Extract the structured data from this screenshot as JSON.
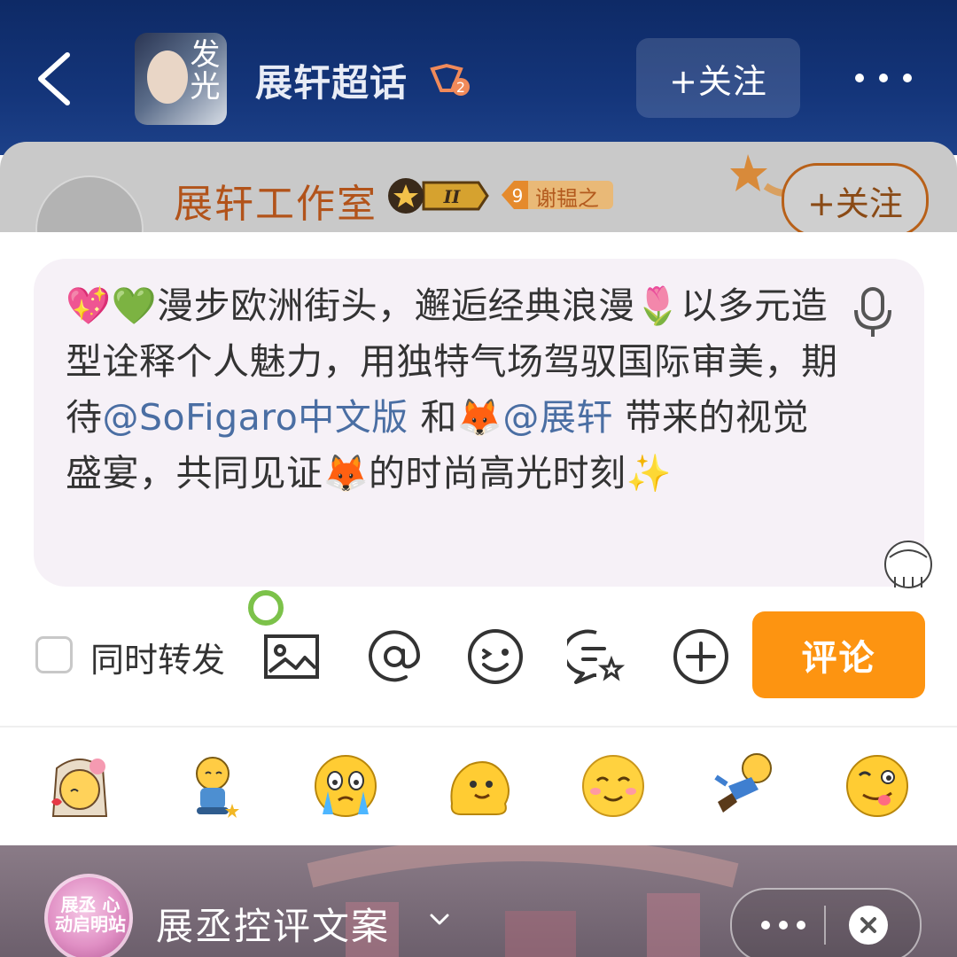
{
  "header": {
    "title": "展轩超话",
    "avatar_text": "发光",
    "level_badge": "2",
    "follow_label": "+关注"
  },
  "card": {
    "name": "展轩工作室",
    "crown_level": "II",
    "fan_level": "9",
    "fan_badge_text": "谢韫之",
    "follow_label": "+关注"
  },
  "comment": {
    "text_before": "💖💚漫步欧洲街头，邂逅经典浪漫🌷以多元造型诠释个人魅力，用独特气场驾驭国际审美，期待",
    "mention1": "@SoFigaro中文版",
    "text_middle": " 和🦊",
    "mention2": "@展轩",
    "text_after": " 带来的视觉盛宴，共同见证🦊的时尚高光时刻✨"
  },
  "toolbar": {
    "repost_label": "同时转发",
    "submit_label": "评论",
    "tools": [
      "image-icon",
      "at-icon",
      "emoji-icon",
      "topic-icon",
      "add-icon"
    ]
  },
  "emojis": [
    "veil-girl-emoji",
    "shy-sit-emoji",
    "crying-emoji",
    "melting-emoji",
    "smile-emoji",
    "flying-emoji",
    "yummy-emoji"
  ],
  "bottom_bar": {
    "avatar_text": "展丞 心动启明站",
    "title": "展丞控评文案"
  },
  "colors": {
    "header_bg": "#14357a",
    "submit_bg": "#fd9411",
    "mention": "#4a6ea3",
    "cursor": "#7cc24a"
  }
}
